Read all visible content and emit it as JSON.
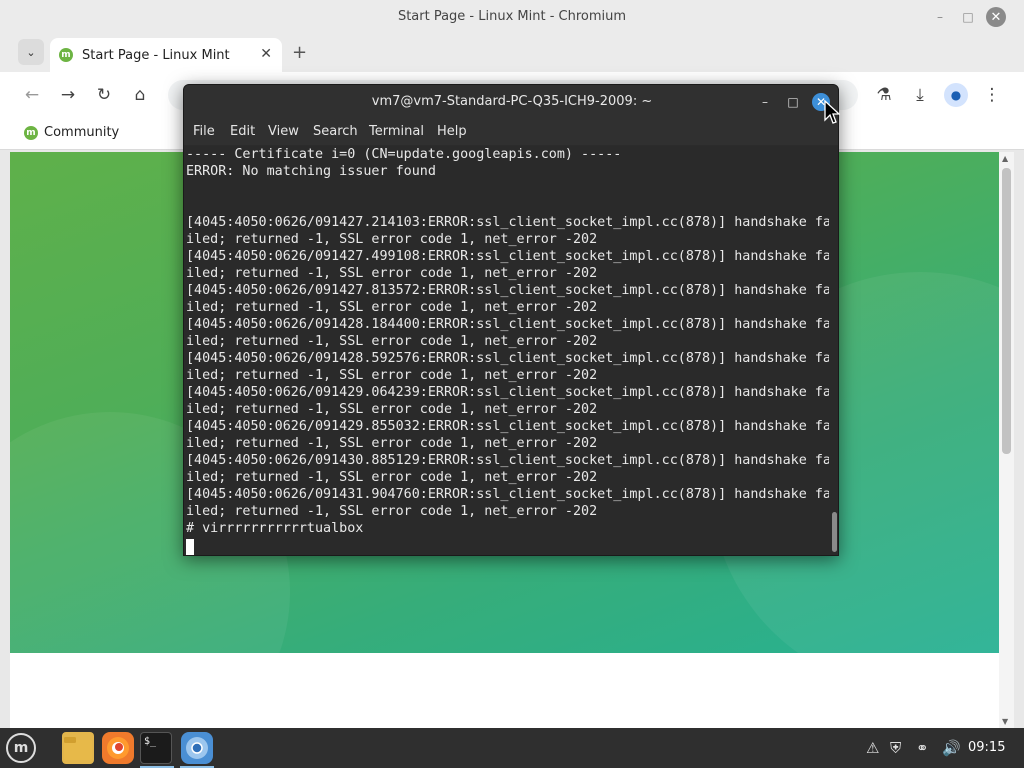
{
  "browser": {
    "window_title": "Start Page - Linux Mint - Chromium",
    "tab_title": "Start Page - Linux Mint",
    "bookmark": "Community",
    "page_gradient": [
      "#5fb04a",
      "#27b193"
    ]
  },
  "terminal": {
    "title": "vm7@vm7-Standard-PC-Q35-ICH9-2009: ~",
    "menu": [
      "File",
      "Edit",
      "View",
      "Search",
      "Terminal",
      "Help"
    ],
    "lines": [
      "----- Certificate i=0 (CN=update.googleapis.com) -----",
      "ERROR: No matching issuer found",
      "",
      "",
      "[4045:4050:0626/091427.214103:ERROR:ssl_client_socket_impl.cc(878)] handshake fa",
      "iled; returned -1, SSL error code 1, net_error -202",
      "[4045:4050:0626/091427.499108:ERROR:ssl_client_socket_impl.cc(878)] handshake fa",
      "iled; returned -1, SSL error code 1, net_error -202",
      "[4045:4050:0626/091427.813572:ERROR:ssl_client_socket_impl.cc(878)] handshake fa",
      "iled; returned -1, SSL error code 1, net_error -202",
      "[4045:4050:0626/091428.184400:ERROR:ssl_client_socket_impl.cc(878)] handshake fa",
      "iled; returned -1, SSL error code 1, net_error -202",
      "[4045:4050:0626/091428.592576:ERROR:ssl_client_socket_impl.cc(878)] handshake fa",
      "iled; returned -1, SSL error code 1, net_error -202",
      "[4045:4050:0626/091429.064239:ERROR:ssl_client_socket_impl.cc(878)] handshake fa",
      "iled; returned -1, SSL error code 1, net_error -202",
      "[4045:4050:0626/091429.855032:ERROR:ssl_client_socket_impl.cc(878)] handshake fa",
      "iled; returned -1, SSL error code 1, net_error -202",
      "[4045:4050:0626/091430.885129:ERROR:ssl_client_socket_impl.cc(878)] handshake fa",
      "iled; returned -1, SSL error code 1, net_error -202",
      "[4045:4050:0626/091431.904760:ERROR:ssl_client_socket_impl.cc(878)] handshake fa",
      "iled; returned -1, SSL error code 1, net_error -202",
      "# virrrrrrrrrrrtualbox"
    ]
  },
  "taskbar": {
    "clock": "09:15",
    "apps": [
      "files-icon",
      "firefox-icon",
      "terminal-icon",
      "chromium-icon"
    ],
    "terminal_glyph": "$_"
  },
  "icons": {
    "minimize": "–",
    "maximize": "□",
    "close": "✕",
    "back": "←",
    "forward": "→",
    "reload": "↻",
    "home": "⌂",
    "labs": "⚗",
    "download": "⤓",
    "profile": "●",
    "kebab": "⋮",
    "plus": "+",
    "chevron": "⌄"
  }
}
